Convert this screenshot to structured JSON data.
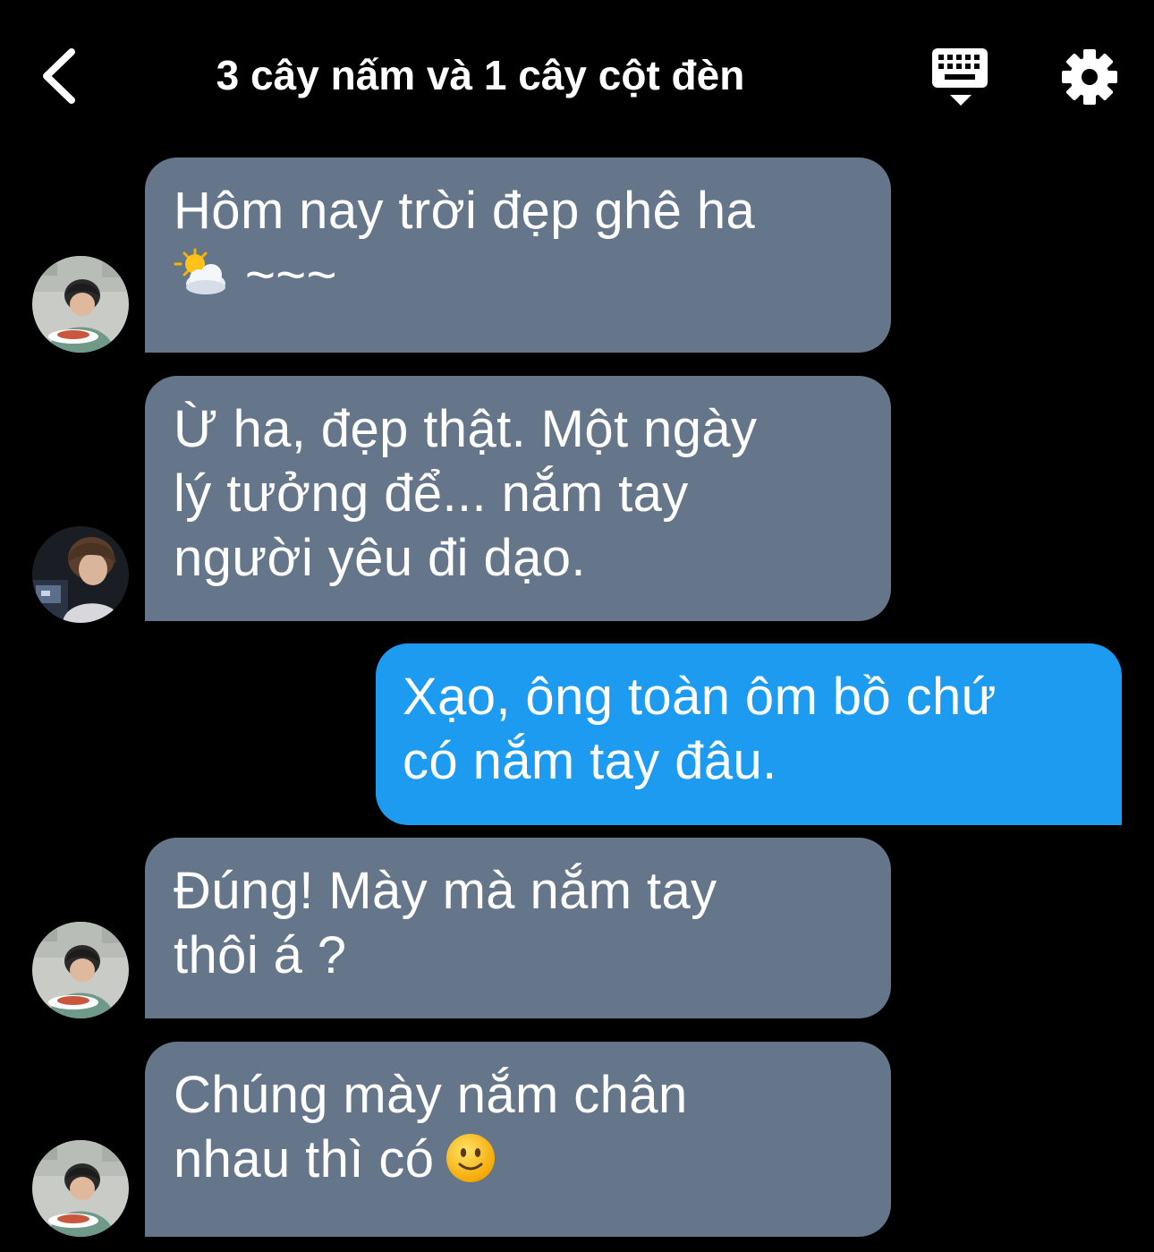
{
  "header": {
    "title": "3 cây nấm và 1 cây cột đèn",
    "back_icon": "chevron-left-icon",
    "keyboard_icon": "keyboard-icon",
    "settings_icon": "gear-icon"
  },
  "colors": {
    "background": "#000000",
    "incoming_bubble": "#65768a",
    "outgoing_bubble": "#1d9bf0",
    "text": "#ffffff"
  },
  "messages": [
    {
      "direction": "incoming",
      "avatar": "avatar-boy-eating",
      "lines": [
        "Hôm nay trời đẹp ghê ha",
        "~~~"
      ],
      "emoji": "sun-behind-cloud-emoji"
    },
    {
      "direction": "incoming",
      "avatar": "avatar-boy-dark",
      "lines": [
        "Ừ ha, đẹp thật. Một ngày",
        "lý tưởng để... nắm tay",
        "người yêu đi dạo."
      ]
    },
    {
      "direction": "outgoing",
      "lines": [
        "Xạo, ông toàn ôm bồ chứ",
        "có nắm tay đâu."
      ]
    },
    {
      "direction": "incoming",
      "avatar": "avatar-boy-eating",
      "lines": [
        "Đúng! Mày mà nắm tay",
        "thôi á ?"
      ]
    },
    {
      "direction": "incoming",
      "avatar": "avatar-boy-eating",
      "lines": [
        "Chúng mày nắm chân",
        "nhau thì có"
      ],
      "emoji": "slightly-smiling-face-emoji"
    }
  ]
}
